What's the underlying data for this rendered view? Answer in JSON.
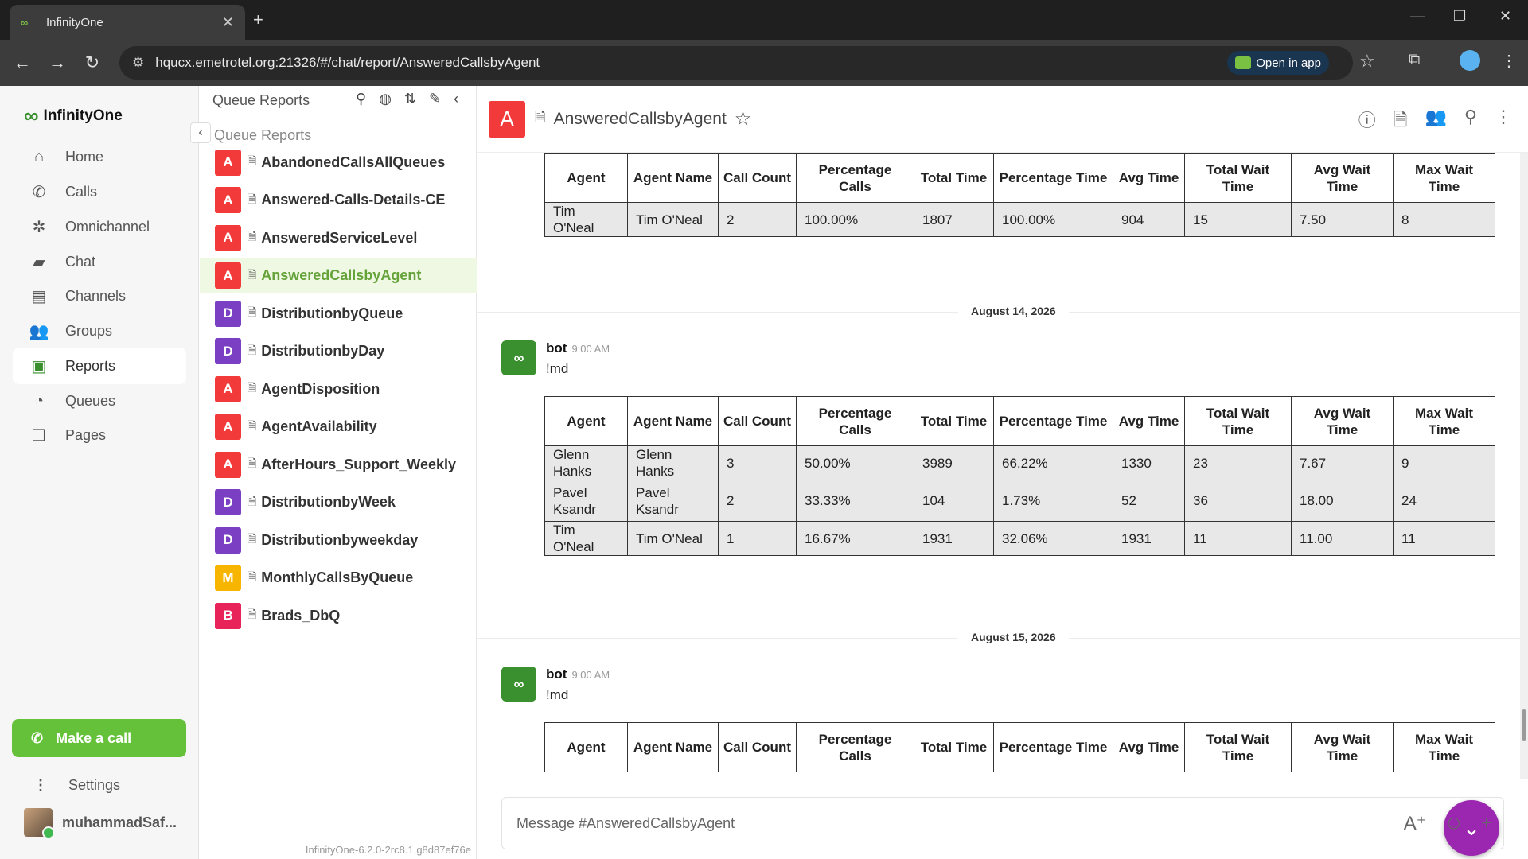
{
  "browser": {
    "tab_title": "InfinityOne",
    "url": "hqucx.emetrotel.org:21326/#/chat/report/AnsweredCallsbyAgent",
    "open_in_app": "Open in app"
  },
  "sidebar": {
    "logo": "InfinityOne",
    "items": [
      {
        "label": "Home",
        "icon": "home-icon"
      },
      {
        "label": "Calls",
        "icon": "phone-icon"
      },
      {
        "label": "Omnichannel",
        "icon": "omnichannel-icon"
      },
      {
        "label": "Chat",
        "icon": "chat-icon"
      },
      {
        "label": "Channels",
        "icon": "channels-icon"
      },
      {
        "label": "Groups",
        "icon": "groups-icon"
      },
      {
        "label": "Reports",
        "icon": "reports-icon"
      },
      {
        "label": "Queues",
        "icon": "queues-icon"
      },
      {
        "label": "Pages",
        "icon": "pages-icon"
      }
    ],
    "make_call": "Make a call",
    "settings": "Settings",
    "user": "muhammadSaf..."
  },
  "queue_panel": {
    "header": "Queue Reports",
    "subheader": "Queue Reports",
    "version": "InfinityOne-6.2.0-2rc8.1.g8d87ef76e",
    "items": [
      {
        "badge": "A",
        "color": "#f23a3a",
        "label": "AbandonedCallsAllQueues"
      },
      {
        "badge": "A",
        "color": "#f23a3a",
        "label": "Answered-Calls-Details-CE"
      },
      {
        "badge": "A",
        "color": "#f23a3a",
        "label": "AnsweredServiceLevel"
      },
      {
        "badge": "A",
        "color": "#f23a3a",
        "label": "AnsweredCallsbyAgent"
      },
      {
        "badge": "D",
        "color": "#7a3fc2",
        "label": "DistributionbyQueue"
      },
      {
        "badge": "D",
        "color": "#7a3fc2",
        "label": "DistributionbyDay"
      },
      {
        "badge": "A",
        "color": "#f23a3a",
        "label": "AgentDisposition"
      },
      {
        "badge": "A",
        "color": "#f23a3a",
        "label": "AgentAvailability"
      },
      {
        "badge": "A",
        "color": "#f23a3a",
        "label": "AfterHours_Support_Weekly"
      },
      {
        "badge": "D",
        "color": "#7a3fc2",
        "label": "DistributionbyWeek"
      },
      {
        "badge": "D",
        "color": "#7a3fc2",
        "label": "Distributionbyweekday"
      },
      {
        "badge": "M",
        "color": "#f7b500",
        "label": "MonthlyCallsByQueue"
      },
      {
        "badge": "B",
        "color": "#e8235a",
        "label": "Brads_DbQ"
      }
    ]
  },
  "room": {
    "avatar": "A",
    "title": "AnsweredCallsbyAgent",
    "composer_placeholder": "Message  #AnsweredCallsbyAgent"
  },
  "table_headers": [
    "Agent",
    "Agent Name",
    "Call Count",
    "Percentage Calls",
    "Total Time",
    "Percentage Time",
    "Avg Time",
    "Total Wait Time",
    "Avg Wait Time",
    "Max Wait Time"
  ],
  "messages": [
    {
      "rows": [
        [
          "Tim O'Neal",
          "Tim O'Neal",
          "2",
          "100.00%",
          "1807",
          "100.00%",
          "904",
          "15",
          "7.50",
          "8"
        ]
      ]
    },
    {
      "date": "August 14, 2026",
      "author": "bot",
      "time": "9:00 AM",
      "text": "!md",
      "rows": [
        [
          "Glenn Hanks",
          "Glenn Hanks",
          "3",
          "50.00%",
          "3989",
          "66.22%",
          "1330",
          "23",
          "7.67",
          "9"
        ],
        [
          "Pavel Ksandr",
          "Pavel Ksandr",
          "2",
          "33.33%",
          "104",
          "1.73%",
          "52",
          "36",
          "18.00",
          "24"
        ],
        [
          "Tim O'Neal",
          "Tim O'Neal",
          "1",
          "16.67%",
          "1931",
          "32.06%",
          "1931",
          "11",
          "11.00",
          "11"
        ]
      ]
    },
    {
      "date": "August 15, 2026",
      "author": "bot",
      "time": "9:00 AM",
      "text": "!md",
      "rows": []
    }
  ]
}
